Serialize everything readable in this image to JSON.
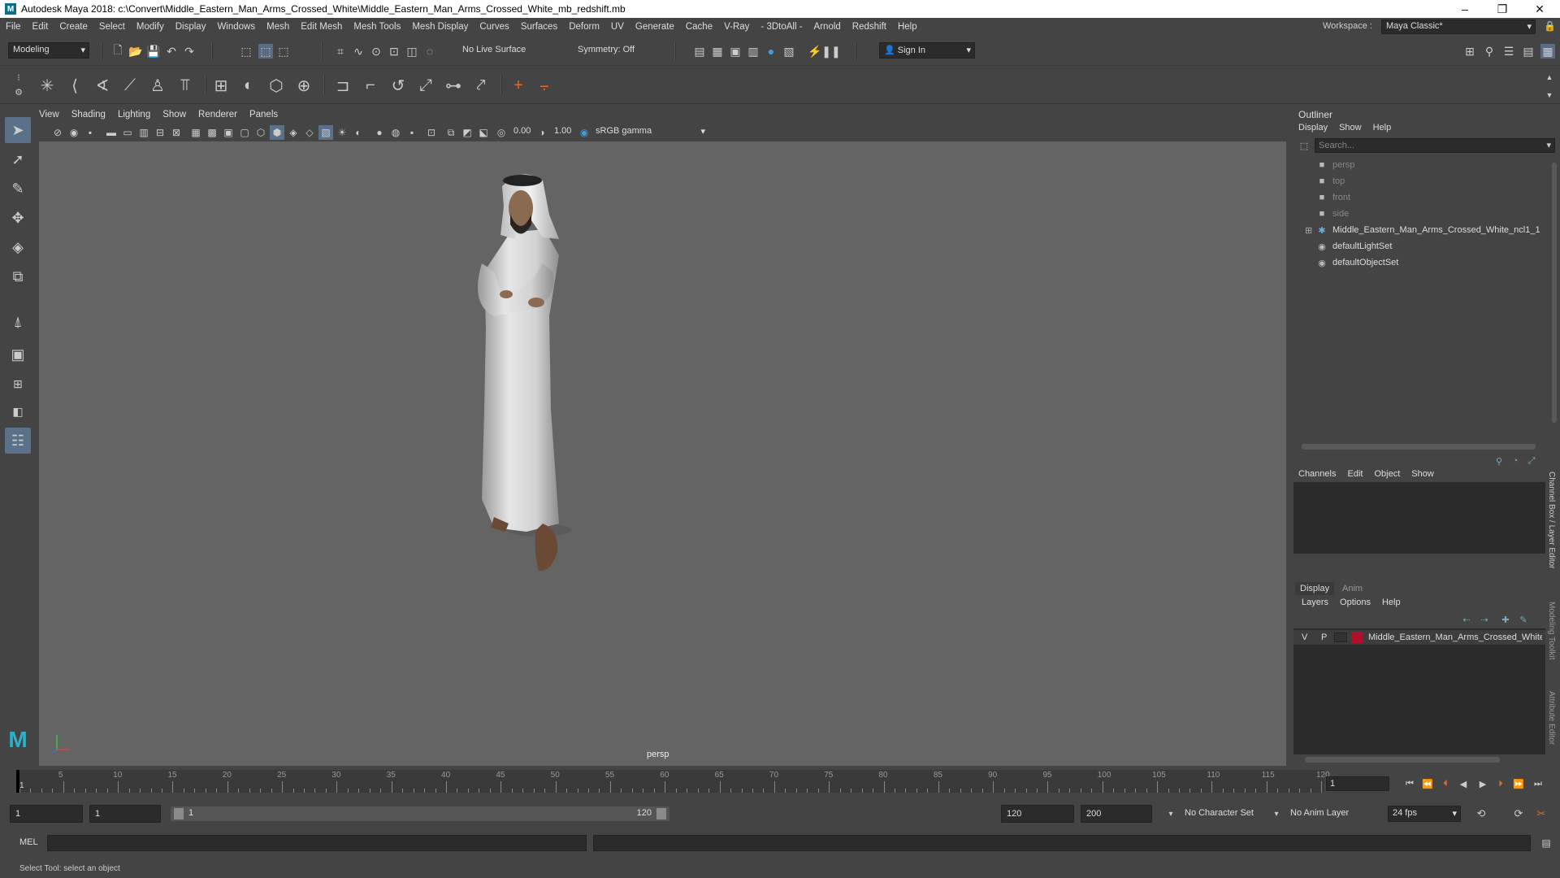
{
  "window": {
    "title": "Autodesk Maya 2018: c:\\Convert\\Middle_Eastern_Man_Arms_Crossed_White\\Middle_Eastern_Man_Arms_Crossed_White_mb_redshift.mb",
    "minimize": "–",
    "maximize": "❐",
    "close": "✕"
  },
  "menubar": {
    "items": [
      "File",
      "Edit",
      "Create",
      "Select",
      "Modify",
      "Display",
      "Windows",
      "Mesh",
      "Edit Mesh",
      "Mesh Tools",
      "Mesh Display",
      "Curves",
      "Surfaces",
      "Deform",
      "UV",
      "Generate",
      "Cache",
      "V-Ray",
      "- 3DtoAll -",
      "Arnold",
      "Redshift",
      "Help"
    ],
    "workspace_label": "Workspace :",
    "workspace_value": "Maya Classic*"
  },
  "toolbar": {
    "mode": "Modeling",
    "live_surface": "No Live Surface",
    "symmetry": "Symmetry: Off",
    "sign_in": "Sign In"
  },
  "viewport": {
    "menu": [
      "View",
      "Shading",
      "Lighting",
      "Show",
      "Renderer",
      "Panels"
    ],
    "exposure": "0.00",
    "gamma": "1.00",
    "color_space": "sRGB gamma",
    "camera_label": "persp"
  },
  "outliner": {
    "title": "Outliner",
    "menu": [
      "Display",
      "Show",
      "Help"
    ],
    "search_placeholder": "Search...",
    "items": [
      {
        "label": "persp",
        "icon": "camera-icon",
        "dim": true
      },
      {
        "label": "top",
        "icon": "camera-icon",
        "dim": true
      },
      {
        "label": "front",
        "icon": "camera-icon",
        "dim": true
      },
      {
        "label": "side",
        "icon": "camera-icon",
        "dim": true
      },
      {
        "label": "Middle_Eastern_Man_Arms_Crossed_White_ncl1_1",
        "icon": "group-icon",
        "dim": false
      },
      {
        "label": "defaultLightSet",
        "icon": "set-icon",
        "dim": false
      },
      {
        "label": "defaultObjectSet",
        "icon": "set-icon",
        "dim": false
      }
    ]
  },
  "channel_box": {
    "menu": [
      "Channels",
      "Edit",
      "Object",
      "Show"
    ],
    "side_tabs": [
      "Channel Box / Layer Editor",
      "Modeling Toolkit",
      "Attribute Editor"
    ]
  },
  "layer_editor": {
    "tabs": [
      "Display",
      "Anim"
    ],
    "menu": [
      "Layers",
      "Options",
      "Help"
    ],
    "layer": {
      "v": "V",
      "p": "P",
      "name": "Middle_Eastern_Man_Arms_Crossed_White",
      "color": "#b0102a"
    }
  },
  "timeline": {
    "ticks": [
      "5",
      "10",
      "15",
      "20",
      "25",
      "30",
      "35",
      "40",
      "45",
      "50",
      "55",
      "60",
      "65",
      "70",
      "75",
      "80",
      "85",
      "90",
      "95",
      "100",
      "105",
      "110",
      "115",
      "120"
    ],
    "current_frame_marker": "1",
    "current_frame": "1"
  },
  "range": {
    "start": "1",
    "playback_start": "1",
    "slider_start": "1",
    "slider_end": "120",
    "playback_end": "120",
    "end": "200",
    "character_set": "No Character Set",
    "anim_layer": "No Anim Layer",
    "fps": "24 fps"
  },
  "command_line": {
    "label": "MEL"
  },
  "status_line": {
    "text": "Select Tool: select an object"
  }
}
